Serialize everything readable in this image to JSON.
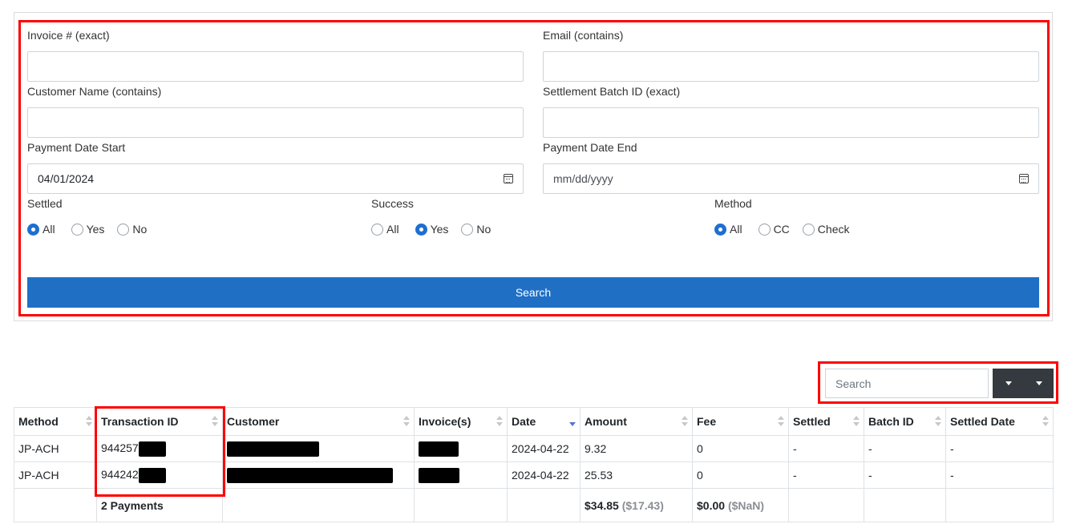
{
  "filters": {
    "invoice": {
      "label": "Invoice # (exact)",
      "value": ""
    },
    "email": {
      "label": "Email (contains)",
      "value": ""
    },
    "customer_name": {
      "label": "Customer Name (contains)",
      "value": ""
    },
    "settlement_batch": {
      "label": "Settlement Batch ID (exact)",
      "value": ""
    },
    "payment_date_start": {
      "label": "Payment Date Start",
      "value": "04/01/2024"
    },
    "payment_date_end": {
      "label": "Payment Date End",
      "placeholder": "mm/dd/yyyy"
    },
    "settled": {
      "label": "Settled",
      "options": [
        "All",
        "Yes",
        "No"
      ],
      "selected": "All"
    },
    "success": {
      "label": "Success",
      "options": [
        "All",
        "Yes",
        "No"
      ],
      "selected": "Yes"
    },
    "method": {
      "label": "Method",
      "options": [
        "All",
        "CC",
        "Check"
      ],
      "selected": "All"
    },
    "search_button": "Search"
  },
  "table_toolbar": {
    "search_placeholder": "Search"
  },
  "table": {
    "columns": [
      "Method",
      "Transaction ID",
      "Customer",
      "Invoice(s)",
      "Date",
      "Amount",
      "Fee",
      "Settled",
      "Batch ID",
      "Settled Date"
    ],
    "rows": [
      {
        "method": "JP-ACH",
        "transaction_id": "944257",
        "date": "2024-04-22",
        "amount": "9.32",
        "fee": "0",
        "settled": "-",
        "batch_id": "-",
        "settled_date": "-"
      },
      {
        "method": "JP-ACH",
        "transaction_id": "944242",
        "date": "2024-04-22",
        "amount": "25.53",
        "fee": "0",
        "settled": "-",
        "batch_id": "-",
        "settled_date": "-"
      }
    ],
    "footer": {
      "count": "2 Payments",
      "amount_total": "$34.85",
      "amount_avg": "($17.43)",
      "fee_total": "$0.00",
      "fee_avg": "($NaN)"
    }
  },
  "colors": {
    "highlight": "#ff0000",
    "primary": "#1f6fc5",
    "dark_button": "#343a40"
  }
}
